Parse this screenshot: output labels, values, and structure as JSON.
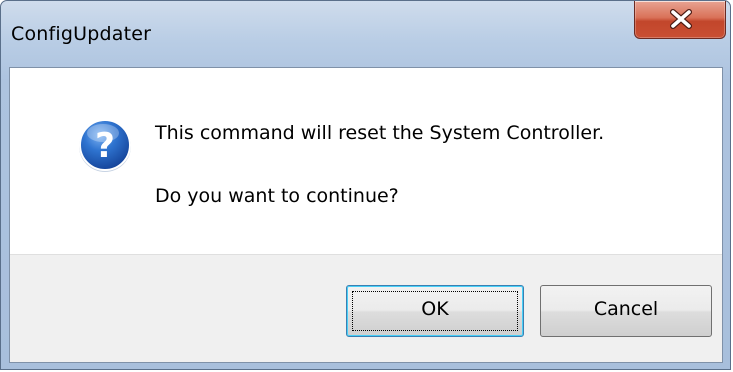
{
  "window": {
    "title": "ConfigUpdater",
    "close_icon": "close-x-icon"
  },
  "message": {
    "icon": "question-icon",
    "line1": "This command will reset the System Controller.",
    "line2": "Do you want to continue?"
  },
  "buttons": {
    "ok_label": "OK",
    "cancel_label": "Cancel"
  },
  "colors": {
    "frame": "#b9cde5",
    "close_button": "#c94f33",
    "icon_blue": "#1f5fb8",
    "footer": "#f0f0f0"
  }
}
